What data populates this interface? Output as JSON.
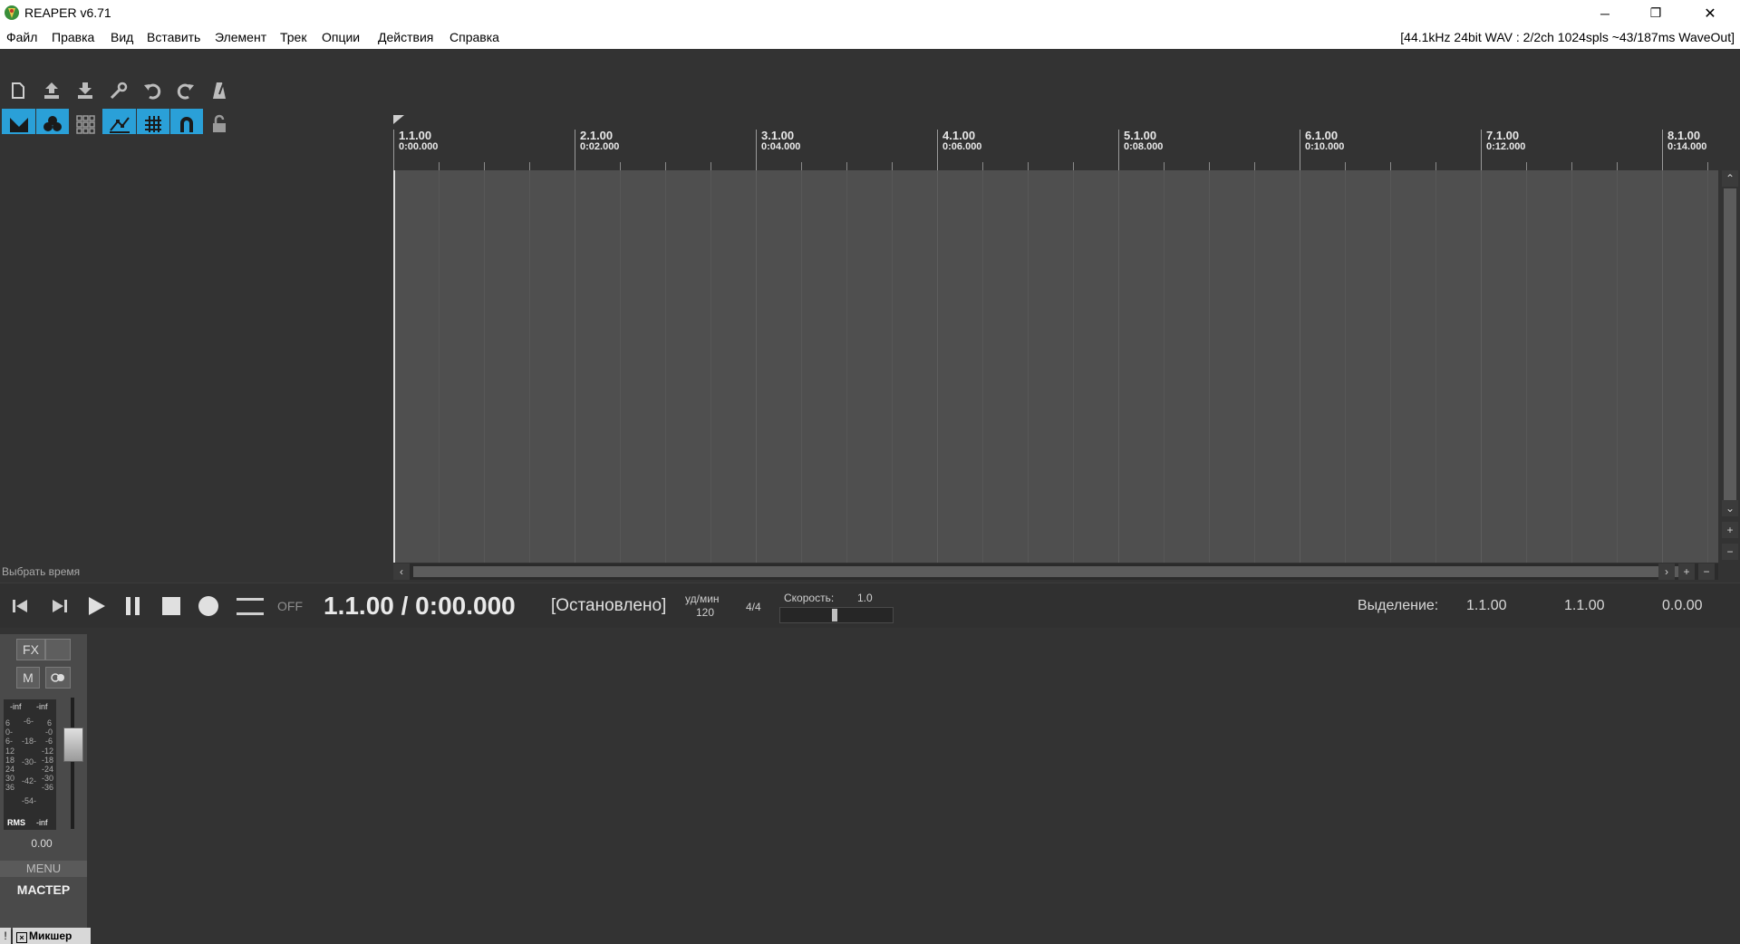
{
  "window": {
    "title": "REAPER v6.71",
    "minimize_glyph": "─",
    "restore_glyph": "❐",
    "close_glyph": "✕"
  },
  "menubar": {
    "items": [
      "Файл",
      "Правка",
      "Вид",
      "Вставить",
      "Элемент",
      "Трек",
      "Опции",
      "Действия",
      "Справка"
    ],
    "audio_status": "[44.1kHz 24bit WAV : 2/2ch 1024spls ~43/187ms WaveOut]"
  },
  "toolbar": {
    "row1": [
      "new-project-icon",
      "open-project-icon",
      "save-project-icon",
      "settings-wrench-icon",
      "undo-icon",
      "redo-icon",
      "metronome-icon"
    ],
    "row2": [
      {
        "name": "auto-crossfade-icon",
        "on": true
      },
      {
        "name": "grouping-icon",
        "on": true
      },
      {
        "name": "grid-lines-icon",
        "on": false
      },
      {
        "name": "envelope-lock-icon",
        "on": true
      },
      {
        "name": "snap-grid-icon",
        "on": true
      },
      {
        "name": "ripple-magnet-icon",
        "on": true
      },
      {
        "name": "lock-icon",
        "on": false
      }
    ],
    "accent_color": "#2aa0d8"
  },
  "tcp": {
    "status_text": "Выбрать время"
  },
  "ruler": {
    "marks": [
      {
        "bar": "1.1.00",
        "time": "0:00.000"
      },
      {
        "bar": "2.1.00",
        "time": "0:02.000"
      },
      {
        "bar": "3.1.00",
        "time": "0:04.000"
      },
      {
        "bar": "4.1.00",
        "time": "0:06.000"
      },
      {
        "bar": "5.1.00",
        "time": "0:08.000"
      },
      {
        "bar": "6.1.00",
        "time": "0:10.000"
      },
      {
        "bar": "7.1.00",
        "time": "0:12.000"
      },
      {
        "bar": "8.1.00",
        "time": "0:14.000"
      }
    ]
  },
  "scroll": {
    "up": "⌃",
    "down": "⌄",
    "zoom_in": "+",
    "zoom_out": "−",
    "left": "‹",
    "right": "›"
  },
  "transport": {
    "off_label": "OFF",
    "position": "1.1.00 / 0:00.000",
    "state": "[Остановлено]",
    "bpm_label": "уд/мин",
    "bpm_value": "120",
    "time_signature": "4/4",
    "rate_label": "Скорость:",
    "rate_value": "1.0",
    "selection_label": "Выделение:",
    "selection_start": "1.1.00",
    "selection_end": "1.1.00",
    "selection_length": "0.0.00"
  },
  "mixer": {
    "fx_label": "FX",
    "mute_label": "M",
    "meter_top_left": "-inf",
    "meter_top_right": "-inf",
    "meter_scale_left": [
      "6",
      "0-",
      "6-",
      "12",
      "18",
      "24",
      "30",
      "36"
    ],
    "meter_scale_mid": [
      "-6-",
      "-18-",
      "-30-",
      "-42-",
      "-54-"
    ],
    "meter_scale_right": [
      "6",
      "-0",
      "-6",
      "-12",
      "-18",
      "-24",
      "-30",
      "-36"
    ],
    "rms_label": "RMS",
    "rms_value": "-inf",
    "volume_value": "0.00",
    "menu_label": "MENU",
    "track_name": "МАСТЕР",
    "tab_label": "Микшер"
  }
}
